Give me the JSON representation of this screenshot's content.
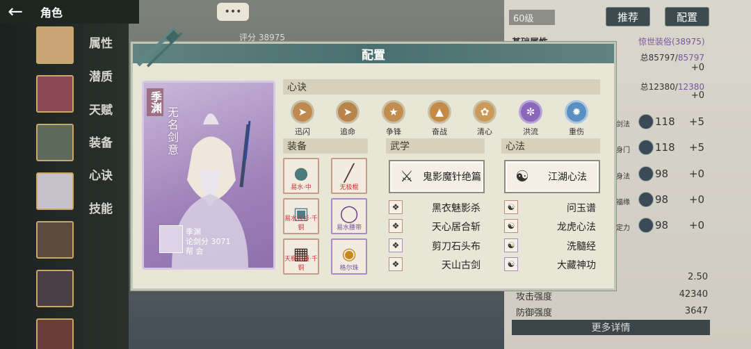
{
  "topbar": {
    "title": "角色"
  },
  "sidebar": {
    "tabs": [
      "属性",
      "潜质",
      "天赋",
      "装备",
      "心诀",
      "技能"
    ]
  },
  "header": {
    "level": "60级",
    "recommend_label": "推荐",
    "config_label": "配置",
    "score": "评分 38975"
  },
  "right_panel": {
    "basic_attr": "基础属性",
    "outfit": "惊世装俗(38975)",
    "line1_label": "总",
    "line1_value": "85797",
    "line1_max": "85797",
    "line1_plus": "+0",
    "line2_label": "总",
    "line2_value": "12380",
    "line2_max": "12380",
    "line2_plus": "+0",
    "stats": [
      {
        "label": "剑法",
        "value": "118",
        "plus": "+5"
      },
      {
        "label": "身门",
        "value": "118",
        "plus": "+5"
      },
      {
        "label": "身法",
        "value": "98",
        "plus": "+0"
      },
      {
        "label": "福缘",
        "value": "98",
        "plus": "+0"
      },
      {
        "label": "定力",
        "value": "98",
        "plus": "+0"
      }
    ],
    "extra": [
      {
        "label": "",
        "value": "2.50"
      },
      {
        "label": "攻击强度",
        "value": "42340"
      },
      {
        "label": "防御强度",
        "value": "3647"
      }
    ],
    "more_label": "更多详情"
  },
  "dialog": {
    "title": "配置",
    "character": {
      "name": "季渊",
      "epithet": "无名剑意",
      "info_name": "季渊",
      "info_score": "论剑分 3071",
      "info_guild": "帮 会"
    },
    "xinjue_label": "心诀",
    "skills": [
      "迅闪",
      "追命",
      "争锋",
      "奋战",
      "清心",
      "洪流",
      "重伤"
    ],
    "equip_label": "装备",
    "equipment": [
      {
        "name": "易水·中",
        "icon": "hat-icon",
        "color": "#c59b89"
      },
      {
        "name": "无极棍",
        "icon": "staff-icon",
        "color": "#c59b89"
      },
      {
        "name": "易水长衫·千铜",
        "icon": "robe-icon",
        "color": "#c59b89"
      },
      {
        "name": "易水腰带",
        "icon": "belt-icon",
        "color": "#a98ac3"
      },
      {
        "name": "天枫古履·千铜",
        "icon": "boots-icon",
        "color": "#c59b89"
      },
      {
        "name": "格尔珠",
        "icon": "bracelet-icon",
        "color": "#a98ac3"
      }
    ],
    "wuxue_label": "武学",
    "wuxue_main": "鬼影魔针绝篇",
    "wuxue_list": [
      "黑衣魅影杀",
      "天心居合斩",
      "剪刀石头布",
      "天山古剑"
    ],
    "xinfa_label": "心法",
    "xinfa_main": "江湖心法",
    "xinfa_list": [
      "问玉谱",
      "龙虎心法",
      "洗髓经",
      "大藏神功"
    ]
  }
}
